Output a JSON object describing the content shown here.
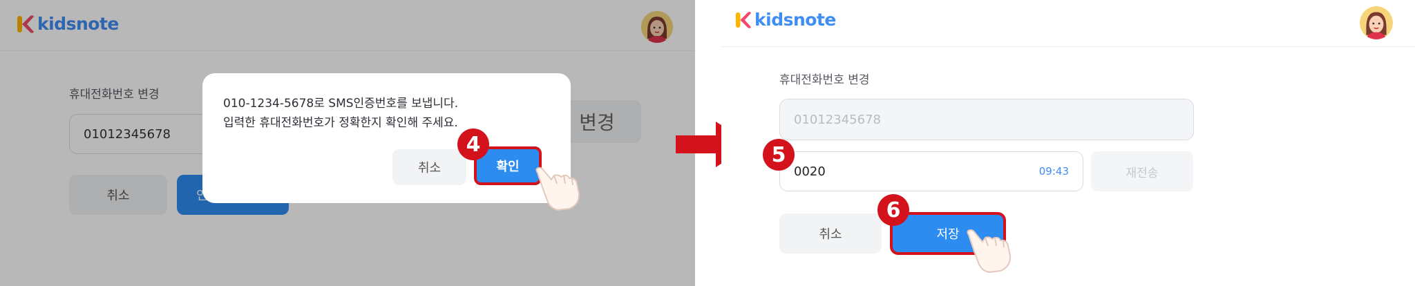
{
  "app": {
    "logo_text": "kidsnote"
  },
  "left_screen": {
    "section_label": "휴대전화번호 변경",
    "phone_value": "01012345678",
    "change_button": "변경",
    "cancel_button": "취소",
    "confirm_button_partial": "인"
  },
  "dialog": {
    "message_line1": "010-1234-5678로 SMS인증번호를 보냅니다.",
    "message_line2": "입력한 휴대전화번호가 정확한지 확인해 주세요.",
    "cancel_label": "취소",
    "ok_label": "확인"
  },
  "right_screen": {
    "section_label": "휴대전화번호 변경",
    "phone_value": "01012345678",
    "code_value": "0020",
    "timer": "09:43",
    "resend_button": "재전송",
    "cancel_button": "취소",
    "save_button": "저장"
  },
  "steps": {
    "step4": "4",
    "step5": "5",
    "step6": "6"
  },
  "colors": {
    "accent": "#2d8cf0",
    "highlight": "#d3121b",
    "logo_blue": "#3f8ef3"
  }
}
